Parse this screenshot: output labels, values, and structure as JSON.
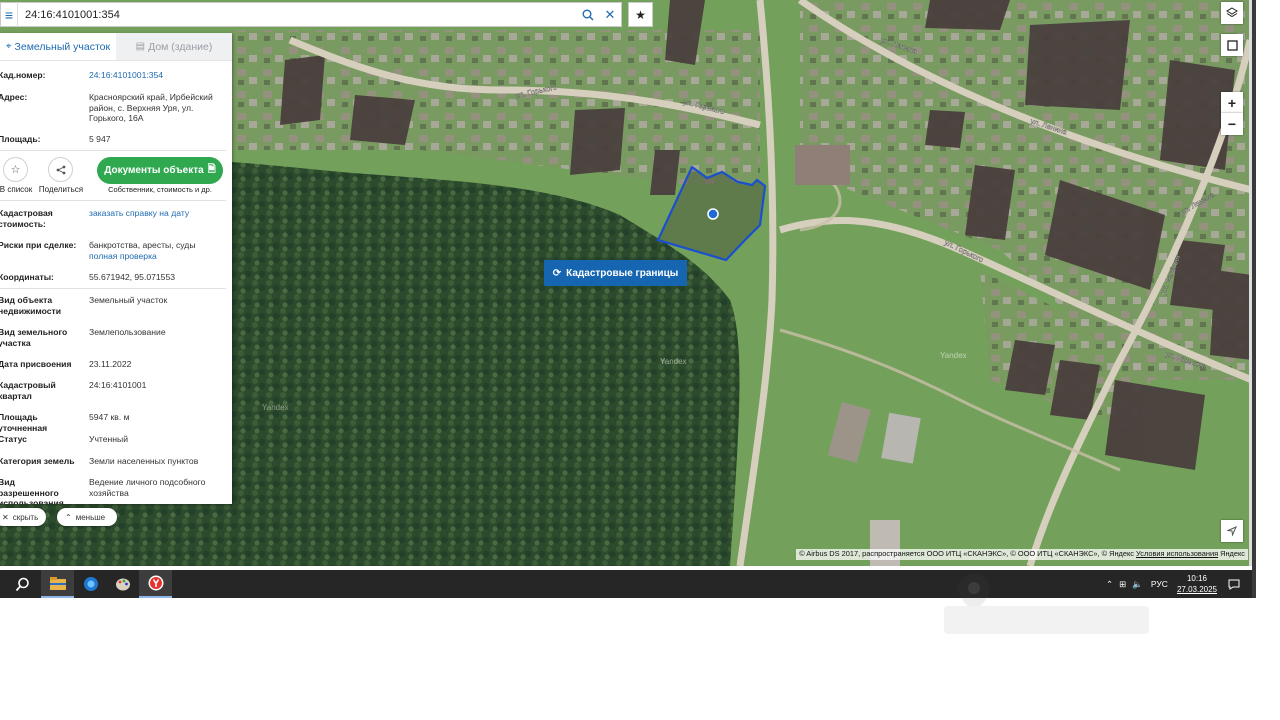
{
  "search": {
    "value": "24:16:4101001:354"
  },
  "tabs": [
    {
      "label": "Земельный участок",
      "active": true
    },
    {
      "label": "Дом (здание)",
      "active": false
    }
  ],
  "info": {
    "cad_number": {
      "label": "Кад.номер:",
      "value": "24:16:4101001:354"
    },
    "address": {
      "label": "Адрес:",
      "value": "Красноярский край, Ирбейский район, с. Верхняя Уря, ул. Горького, 16А"
    },
    "area": {
      "label": "Площадь:",
      "value": "5 947"
    }
  },
  "actions": {
    "add_to_list": "В список",
    "share": "Поделиться",
    "docs_button": "Документы объекта",
    "docs_caption": "Собственник, стоимость и др."
  },
  "details": {
    "cad_value": {
      "label": "Кадастровая стоимость:",
      "value": "заказать справку на дату"
    },
    "risks": {
      "label": "Риски при сделке:",
      "value": "банкротства, аресты, суды",
      "link": "полная проверка"
    },
    "coords": {
      "label": "Координаты:",
      "value": "55.671942, 95.071553"
    },
    "object_type": {
      "label": "Вид объекта недвижимости",
      "value": "Земельный участок"
    },
    "land_type": {
      "label": "Вид земельного участка",
      "value": "Землепользование"
    },
    "assign_date": {
      "label": "Дата присвоения",
      "value": "23.11.2022"
    },
    "quarter": {
      "label": "Кадастровый квартал",
      "value": "24:16:4101001"
    },
    "area_precise": {
      "label": "Площадь уточненная",
      "value": "5947 кв. м"
    },
    "status": {
      "label": "Статус",
      "value": "Учтенный"
    },
    "category": {
      "label": "Категория земель",
      "value": "Земли населенных пунктов"
    },
    "permitted_use": {
      "label": "Вид разрешенного использования",
      "value": "Ведение личного подсобного хозяйства"
    }
  },
  "panel_buttons": {
    "hide": "скрыть",
    "less": "меньше"
  },
  "map": {
    "cadastral_button": "Кадастровые границы",
    "street_labels": [
      "ул. Горького",
      "ул. Горького",
      "ул. Горького",
      "ул. Ленина",
      "ул. Ленина",
      "ул. Ленина",
      "ул. Горького",
      "ул. Зелёная"
    ],
    "zoom_in": "+",
    "zoom_out": "−",
    "attribution": "© Airbus DS 2017, распространяется ООО ИТЦ «СКАНЭКС», © ООО ИТЦ «СКАНЭКС», © Яндекс",
    "terms": "Условия использования",
    "brand": "Яндекс"
  },
  "taskbar": {
    "lang": "РУС",
    "time": "10:16",
    "date": "27.03.2025"
  },
  "colors": {
    "accent": "#1565b0",
    "docs_green": "#2fa84f",
    "parcel": "#1a4fd0"
  }
}
